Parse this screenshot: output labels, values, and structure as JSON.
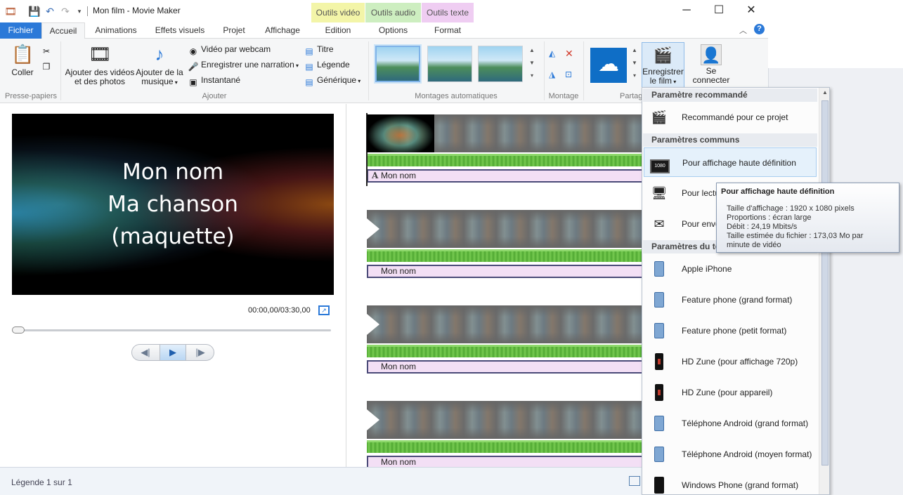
{
  "window": {
    "title": "Mon film - Movie Maker",
    "controls": {
      "minimize": "─",
      "maximize": "☐",
      "close": "✕"
    }
  },
  "context_tabs": {
    "video_tools": "Outils vidéo",
    "audio_tools": "Outils audio",
    "text_tools": "Outils texte"
  },
  "tabs": {
    "file": "Fichier",
    "home": "Accueil",
    "animations": "Animations",
    "visual_effects": "Effets visuels",
    "project": "Projet",
    "view": "Affichage",
    "edit": "Edition",
    "options": "Options",
    "format": "Format"
  },
  "ribbon": {
    "clipboard": {
      "paste": "Coller",
      "group": "Presse-papiers"
    },
    "add": {
      "add_videos_line1": "Ajouter des vidéos",
      "add_videos_line2": "et des photos",
      "add_music_line1": "Ajouter de la",
      "add_music_line2": "musique",
      "webcam_video": "Vidéo par webcam",
      "record_narration": "Enregistrer une narration",
      "snapshot": "Instantané",
      "title": "Titre",
      "caption": "Légende",
      "credits": "Générique",
      "group": "Ajouter"
    },
    "automovie": {
      "group": "Montages automatiques"
    },
    "editing": {
      "group": "Montage"
    },
    "share": {
      "group": "Partag"
    },
    "save_film_line1": "Enregistrer",
    "save_film_line2": "le film",
    "sign_in_line1": "Se",
    "sign_in_line2": "connecter"
  },
  "preview": {
    "lines": [
      "Mon nom",
      "Ma chanson",
      "(maquette)"
    ],
    "timecode": "00:00,00/03:30,00"
  },
  "storyboard": {
    "captions": [
      "Mon nom",
      "Mon nom",
      "Mon nom",
      "Mon nom"
    ]
  },
  "status": {
    "text": "Légende 1 sur 1"
  },
  "save_menu": {
    "recommended_header": "Paramètre recommandé",
    "recommended_item": "Recommandé pour ce projet",
    "common_header": "Paramètres communs",
    "hd_display": "Pour affichage haute définition",
    "computer_playback": "Pour lectu",
    "email": "Pour envo",
    "devices_header": "Paramètres du télé",
    "devices": [
      "Apple iPhone",
      "Feature phone (grand format)",
      "Feature phone (petit format)",
      "HD Zune (pour affichage 720p)",
      "HD Zune (pour appareil)",
      "Téléphone Android (grand format)",
      "Téléphone Android (moyen format)",
      "Windows Phone (grand format)"
    ]
  },
  "tooltip": {
    "title": "Pour affichage haute définition",
    "size": "Taille d'affichage : 1920 x 1080 pixels",
    "ratio": "Proportions : écran large",
    "bitrate": "Débit : 24,19 Mbits/s",
    "filesize_line1": "Taille estimée du fichier : 173,03 Mo par",
    "filesize_line2": "minute de vidéo"
  },
  "colors": {
    "accent": "#2b79d8",
    "video_tools": "#f3f5a8",
    "audio_tools": "#cdeec0",
    "text_tools": "#efcdf2",
    "caption_bar": "#f3dff5",
    "audio_wave": "#4fa832"
  },
  "icons": {
    "app": "movie-maker-icon",
    "hd_display": "monitor-1080-icon",
    "device": "phone-camera-icon",
    "cloud": "onedrive-cloud-icon"
  }
}
